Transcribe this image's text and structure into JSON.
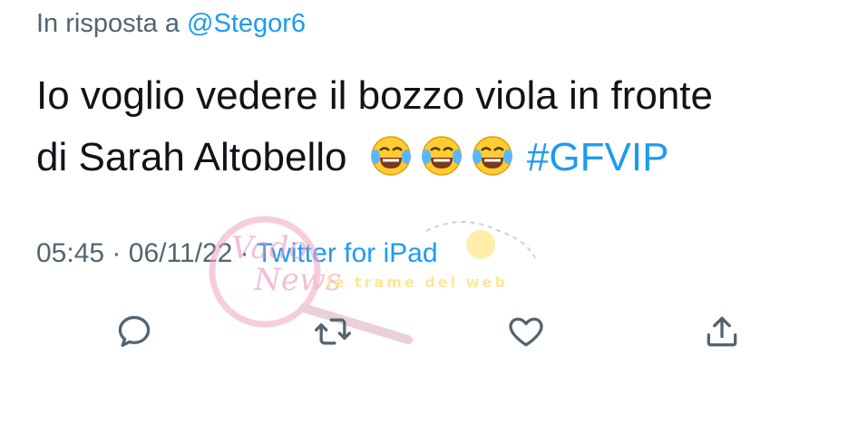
{
  "reply": {
    "prefix": "In risposta a",
    "handle": "@Stegor6"
  },
  "tweet": {
    "line1": "Io voglio vedere il bozzo viola in fronte",
    "line2": "di Sarah Altobello",
    "emoji": [
      "face-with-tears-of-joy-icon",
      "face-with-tears-of-joy-icon",
      "face-with-tears-of-joy-icon"
    ],
    "hashtag": "#GFVIP"
  },
  "meta": {
    "time": "05:45",
    "separator": "·",
    "date": "06/11/22",
    "source": "Twitter for iPad"
  },
  "actions": [
    "reply-icon",
    "retweet-icon",
    "like-icon",
    "share-icon"
  ],
  "watermark": {
    "brand": "Vado della News",
    "tagline": "le trame del web"
  },
  "colors": {
    "text": "#0f1419",
    "secondary": "#536471",
    "accent": "#1d9bf0"
  }
}
